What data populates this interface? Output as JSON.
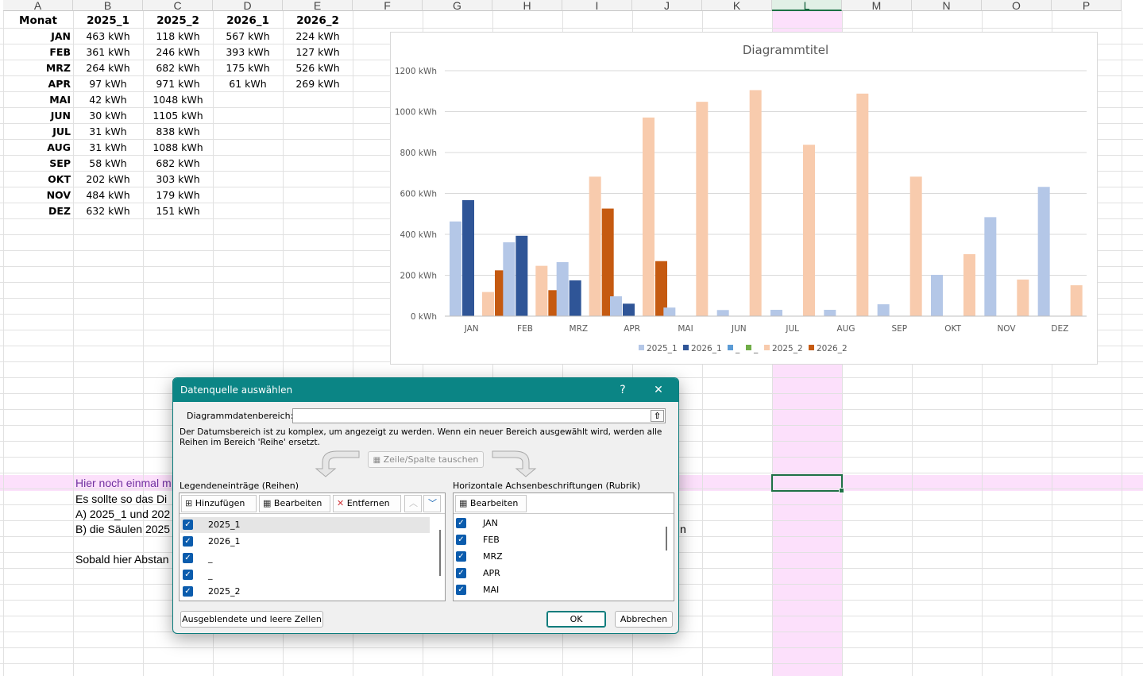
{
  "columns": [
    "A",
    "B",
    "C",
    "D",
    "E",
    "F",
    "G",
    "H",
    "I",
    "J",
    "K",
    "L",
    "M",
    "N",
    "O",
    "P"
  ],
  "table": {
    "headers": [
      "Monat",
      "2025_1",
      "2025_2",
      "2026_1",
      "2026_2"
    ],
    "rows": [
      [
        "JAN",
        "463 kWh",
        "118 kWh",
        "567 kWh",
        "224 kWh"
      ],
      [
        "FEB",
        "361 kWh",
        "246 kWh",
        "393 kWh",
        "127 kWh"
      ],
      [
        "MRZ",
        "264 kWh",
        "682 kWh",
        "175 kWh",
        "526 kWh"
      ],
      [
        "APR",
        "97 kWh",
        "971 kWh",
        "61 kWh",
        "269 kWh"
      ],
      [
        "MAI",
        "42 kWh",
        "1048 kWh",
        "",
        ""
      ],
      [
        "JUN",
        "30 kWh",
        "1105 kWh",
        "",
        ""
      ],
      [
        "JUL",
        "31 kWh",
        "838 kWh",
        "",
        ""
      ],
      [
        "AUG",
        "31 kWh",
        "1088 kWh",
        "",
        ""
      ],
      [
        "SEP",
        "58 kWh",
        "682 kWh",
        "",
        ""
      ],
      [
        "OKT",
        "202 kWh",
        "303 kWh",
        "",
        ""
      ],
      [
        "NOV",
        "484 kWh",
        "179 kWh",
        "",
        ""
      ],
      [
        "DEZ",
        "632 kWh",
        "151 kWh",
        "",
        ""
      ]
    ]
  },
  "notes": {
    "line1": "Hier noch einmal m",
    "line1_right": "",
    "line2": "Es sollte so das Di",
    "line3": "A) 2025_1 und 202",
    "line4": "B) die Säulen 2025",
    "line4_right": "n",
    "line5": "Sobald hier Abstan"
  },
  "chart_data": {
    "type": "bar",
    "title": "Diagrammtitel",
    "categories": [
      "JAN",
      "FEB",
      "MRZ",
      "APR",
      "MAI",
      "JUN",
      "JUL",
      "AUG",
      "SEP",
      "OKT",
      "NOV",
      "DEZ"
    ],
    "ylim": [
      0,
      1200
    ],
    "yticks": [
      "0 kWh",
      "200 kWh",
      "400 kWh",
      "600 kWh",
      "800 kWh",
      "1000 kWh",
      "1200 kWh"
    ],
    "ytick_values": [
      0,
      200,
      400,
      600,
      800,
      1000,
      1200
    ],
    "grid": true,
    "legend_position": "bottom",
    "series": [
      {
        "name": "2025_1",
        "color": "#b4c7e7",
        "values": [
          463,
          361,
          264,
          97,
          42,
          30,
          31,
          31,
          58,
          202,
          484,
          632
        ]
      },
      {
        "name": "2026_1",
        "color": "#2f5597",
        "values": [
          567,
          393,
          175,
          61,
          null,
          null,
          null,
          null,
          null,
          null,
          null,
          null
        ]
      },
      {
        "name": "_",
        "color": "#5b9bd5",
        "values": [
          null,
          null,
          null,
          null,
          null,
          null,
          null,
          null,
          null,
          null,
          null,
          null
        ]
      },
      {
        "name": "_",
        "color": "#70ad47",
        "values": [
          null,
          null,
          null,
          null,
          null,
          null,
          null,
          null,
          null,
          null,
          null,
          null
        ]
      },
      {
        "name": "2025_2",
        "color": "#f8cbad",
        "values": [
          118,
          246,
          682,
          971,
          1048,
          1105,
          838,
          1088,
          682,
          303,
          179,
          151
        ]
      },
      {
        "name": "2026_2",
        "color": "#c55a11",
        "values": [
          224,
          127,
          526,
          269,
          null,
          null,
          null,
          null,
          null,
          null,
          null,
          null
        ]
      }
    ]
  },
  "dialog": {
    "title": "Datenquelle auswählen",
    "help": "?",
    "close": "✕",
    "range_label": "Diagrammdatenbereich:",
    "range_value": "",
    "info": "Der Datumsbereich ist zu komplex, um angezeigt zu werden. Wenn ein neuer Bereich ausgewählt wird, werden alle Reihen im Bereich 'Reihe' ersetzt.",
    "switch_button": "Zeile/Spalte tauschen",
    "legend_label": "Legendeneinträge (Reihen)",
    "axis_label": "Horizontale Achsenbeschriftungen (Rubrik)",
    "add": "Hinzufügen",
    "edit": "Bearbeiten",
    "remove": "Entfernen",
    "edit_axis": "Bearbeiten",
    "series_items": [
      "2025_1",
      "2026_1",
      "_",
      "_",
      "2025_2"
    ],
    "axis_items": [
      "JAN",
      "FEB",
      "MRZ",
      "APR",
      "MAI"
    ],
    "hidden_cells": "Ausgeblendete und leere Zellen",
    "ok": "OK",
    "cancel": "Abbrechen"
  }
}
